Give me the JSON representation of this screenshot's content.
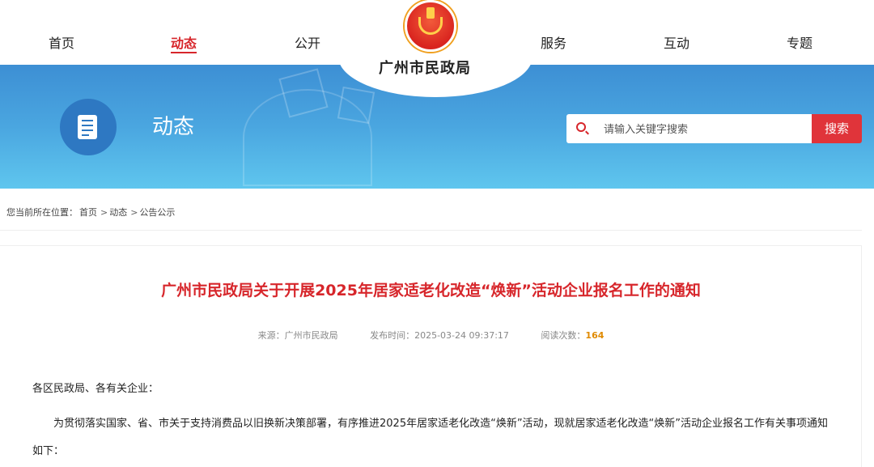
{
  "nav": {
    "items": [
      {
        "label": "首页"
      },
      {
        "label": "动态"
      },
      {
        "label": "公开"
      },
      {
        "label": "服务"
      },
      {
        "label": "互动"
      },
      {
        "label": "专题"
      }
    ],
    "active_index": 1
  },
  "logo": {
    "name": "广州市民政局"
  },
  "banner": {
    "section_title": "动态",
    "search_placeholder": "请输入关键字搜索",
    "search_button": "搜索"
  },
  "breadcrumb": {
    "prefix": "您当前所在位置：",
    "items": [
      "首页",
      "动态",
      "公告公示"
    ]
  },
  "article": {
    "title": "广州市民政局关于开展2025年居家适老化改造“焕新”活动企业报名工作的通知",
    "source": "来源：广州市民政局",
    "publish_time": "发布时间：2025-03-24 09:37:17",
    "read_label": "阅读次数：",
    "read_count": "164",
    "salutation": "各区民政局、各有关企业：",
    "paragraph1": "为贯彻落实国家、省、市关于支持消费品以旧换新决策部署，有序推进2025年居家适老化改造“焕新”活动，现就居家适老化改造“焕新”活动企业报名工作有关事项通知如下："
  },
  "colors": {
    "accent_red": "#d7262b",
    "banner_blue": "#4aa6e0",
    "count_orange": "#e08a00"
  }
}
